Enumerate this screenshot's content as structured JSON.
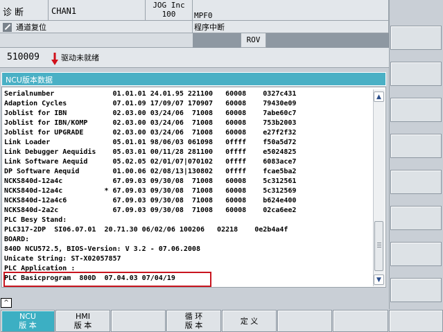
{
  "header": {
    "area": "诊断",
    "channel": "CHAN1",
    "mode_line1": "JOG Inc",
    "mode_line2": "100",
    "program": "MPF0",
    "channel_status": "通道复位",
    "program_status": "程序中断",
    "rov": "ROV"
  },
  "alarm": {
    "number": "510009",
    "text": "驱动未就绪"
  },
  "panel": {
    "title": "NCU版本数据",
    "rows": [
      "Serialnumber              01.01.01 24.01.95 221100   60008    0327c431",
      "Adaption Cycles           07.01.09 17/09/07 170907   60008    79430e09",
      "Joblist for IBN           02.03.00 03/24/06  71008   60008    7abe60c7",
      "Joblist for IBN/KOMP      02.03.00 03/24/06  71008   60008    753b2003",
      "Joblist for UPGRADE       02.03.00 03/24/06  71008   60008    e27f2f32",
      "Link Loader               05.01.01 98/06/03 061098   0ffff    f50a5d72",
      "Link Debugger Aequidis    05.03.01 00/11/28 281100   0ffff    e5024825",
      "Link Software Aequid      05.02.05 02/01/07|070102   0ffff    6083ace7",
      "DP Software Aequid        01.00.06 02/08/13|130802   0ffff    fcae5ba2",
      "NCKS840d-12a4c            67.09.03 09/30/08  71008   60008    5c312561",
      "NCKS840d-12a4c          * 67.09.03 09/30/08  71008   60008    5c312569",
      "NCKS840d-12a4c6           67.09.03 09/30/08  71008   60008    b624e400",
      "NCKS840d-2a2c             67.09.03 09/30/08  71008   60008    02ca6ee2",
      "PLC Besy Stand:",
      "PLC317-2DP  SI06.07.01  20.71.30 06/02/06 100206   02218    0e2b4a4f",
      "BOARD:",
      "840D NCU572.5, BIOS-Version: V 3.2 - 07.06.2008",
      "Unicate String: ST-X02057857",
      "PLC Application :",
      "PLC Basicprogram  800D  07.04.03 07/04/19"
    ]
  },
  "scroll": {
    "up": "▲",
    "down": "▼"
  },
  "recall": "^",
  "softkeys": [
    {
      "line1": "NCU",
      "line2": "版 本"
    },
    {
      "line1": "HMI",
      "line2": "版 本"
    },
    {
      "line1": "",
      "line2": ""
    },
    {
      "line1": "循 环",
      "line2": "版 本"
    },
    {
      "line1": "定 义",
      "line2": ""
    },
    {
      "line1": "",
      "line2": ""
    },
    {
      "line1": "",
      "line2": ""
    },
    {
      "line1": "",
      "line2": ""
    }
  ],
  "colors": {
    "title_bar": "#4ab0c5",
    "active_softkey": "#3cafc3",
    "highlight_box": "#c8141e",
    "alarm_arrow": "#d0101a"
  }
}
